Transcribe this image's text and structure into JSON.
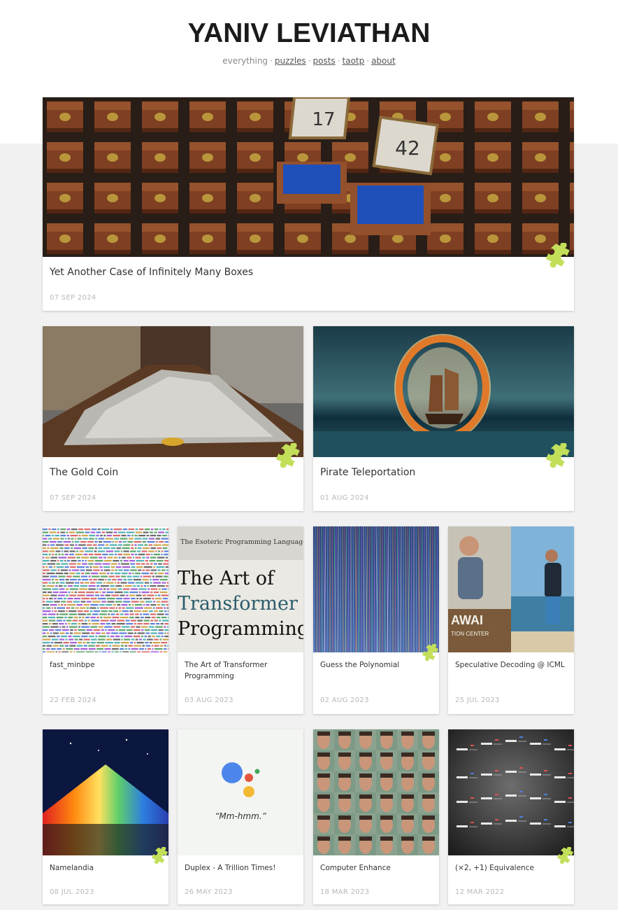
{
  "site": {
    "title": "YANIV LEVIATHAN"
  },
  "nav": {
    "everything": "everything",
    "puzzles": "puzzles",
    "posts": "posts",
    "taotp": "taotp",
    "about": "about"
  },
  "colors": {
    "puzzle_green": "#c3df5a",
    "date_gray": "#b8b8b8"
  },
  "cards": [
    {
      "title": "Yet Another Case of Infinitely Many Boxes",
      "date": "07 SEP 2024",
      "puzzle": true,
      "icon": "puzzle-icon",
      "box_numbers": [
        "17",
        "42"
      ]
    },
    {
      "title": "The Gold Coin",
      "date": "07 SEP 2024",
      "puzzle": true,
      "icon": "puzzle-icon"
    },
    {
      "title": "Pirate Teleportation",
      "date": "01 AUG 2024",
      "puzzle": true,
      "icon": "puzzle-icon"
    },
    {
      "title": "fast_minbpe",
      "date": "22 FEB 2024",
      "puzzle": false
    },
    {
      "title": "The Art of Transformer Programming",
      "date": "03 AUG 2023",
      "puzzle": false,
      "image_text": {
        "header": "The Esoteric Programming Language at the Heart of Modern AI",
        "line1": "The Art of",
        "line2": "Transformer",
        "line3": "Programming"
      }
    },
    {
      "title": "Guess the Polynomial",
      "date": "02 AUG 2023",
      "puzzle": true,
      "icon": "puzzle-icon"
    },
    {
      "title": "Speculative Decoding @ ICML",
      "date": "25 JUL 2023",
      "puzzle": false,
      "image_text": {
        "sign": "AWAI",
        "sign2": "TION CENTER"
      }
    },
    {
      "title": "Namelandia",
      "date": "08 JUL 2023",
      "puzzle": true,
      "icon": "puzzle-icon"
    },
    {
      "title": "Duplex - A Trillion Times!",
      "date": "26 MAY 2023",
      "puzzle": false,
      "image_text": {
        "quote": "“Mm-hmm.”"
      }
    },
    {
      "title": "Computer Enhance",
      "date": "18 MAR 2023",
      "puzzle": false
    },
    {
      "title": "(×2, +1) Equivalence",
      "date": "12 MAR 2022",
      "puzzle": true,
      "icon": "puzzle-icon"
    }
  ]
}
